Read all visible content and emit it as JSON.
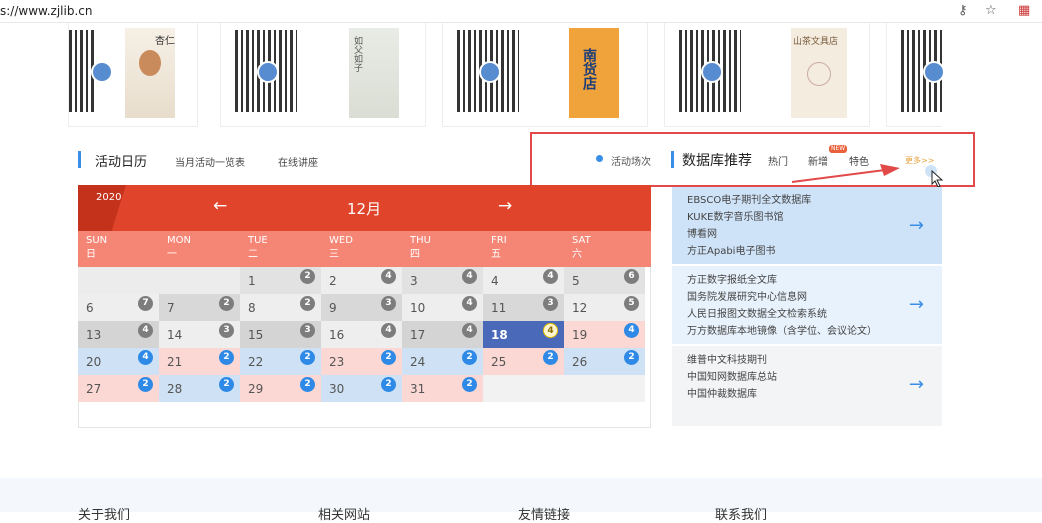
{
  "browser": {
    "url": "s://www.zjlib.cn"
  },
  "activity": {
    "title": "活动日历",
    "tab_month": "当月活动一览表",
    "tab_lecture": "在线讲座",
    "legend": "活动场次"
  },
  "database": {
    "title": "数据库推荐",
    "tab_hot": "热门",
    "tab_new": "新增",
    "new_badge": "NEW",
    "tab_special": "特色",
    "more": "更多>>",
    "groups": [
      {
        "lines": [
          "EBSCO电子期刊全文数据库",
          "KUKE数字音乐图书馆",
          "博看网",
          "方正Apabi电子图书"
        ]
      },
      {
        "lines": [
          "方正数字报纸全文库",
          "国务院发展研究中心信息网",
          "人民日报图文数据全文检索系统",
          "万方数据库本地镜像（含学位、会议论文）"
        ]
      },
      {
        "lines": [
          "维普中文科技期刊",
          "中国知网数据库总站",
          "中国仲裁数据库"
        ]
      }
    ]
  },
  "calendar": {
    "year": "2020",
    "month": "12月",
    "prev_glyph": "←",
    "next_glyph": "→",
    "weekdays": [
      {
        "en": "SUN",
        "cn": "日"
      },
      {
        "en": "MON",
        "cn": "一"
      },
      {
        "en": "TUE",
        "cn": "二"
      },
      {
        "en": "WED",
        "cn": "三"
      },
      {
        "en": "THU",
        "cn": "四"
      },
      {
        "en": "FRI",
        "cn": "五"
      },
      {
        "en": "SAT",
        "cn": "六"
      }
    ],
    "days": [
      {
        "d": "",
        "c": ""
      },
      {
        "d": "",
        "c": ""
      },
      {
        "d": "1",
        "c": "2"
      },
      {
        "d": "2",
        "c": "4"
      },
      {
        "d": "3",
        "c": "4"
      },
      {
        "d": "4",
        "c": "4"
      },
      {
        "d": "5",
        "c": "6"
      },
      {
        "d": "6",
        "c": "7"
      },
      {
        "d": "7",
        "c": "2"
      },
      {
        "d": "8",
        "c": "2"
      },
      {
        "d": "9",
        "c": "3"
      },
      {
        "d": "10",
        "c": "4"
      },
      {
        "d": "11",
        "c": "3"
      },
      {
        "d": "12",
        "c": "5"
      },
      {
        "d": "13",
        "c": "4"
      },
      {
        "d": "14",
        "c": "3"
      },
      {
        "d": "15",
        "c": "3"
      },
      {
        "d": "16",
        "c": "4"
      },
      {
        "d": "17",
        "c": "4"
      },
      {
        "d": "18",
        "c": "4"
      },
      {
        "d": "19",
        "c": "4"
      },
      {
        "d": "20",
        "c": "4"
      },
      {
        "d": "21",
        "c": "2"
      },
      {
        "d": "22",
        "c": "2"
      },
      {
        "d": "23",
        "c": "2"
      },
      {
        "d": "24",
        "c": "2"
      },
      {
        "d": "25",
        "c": "2"
      },
      {
        "d": "26",
        "c": "2"
      },
      {
        "d": "27",
        "c": "2"
      },
      {
        "d": "28",
        "c": "2"
      },
      {
        "d": "29",
        "c": "2"
      },
      {
        "d": "30",
        "c": "2"
      },
      {
        "d": "31",
        "c": "2"
      },
      {
        "d": "",
        "c": ""
      },
      {
        "d": "",
        "c": ""
      }
    ],
    "today": "18"
  },
  "books": [
    {
      "title": "杏仁"
    },
    {
      "title": "如父如子"
    },
    {
      "title": "南货店"
    },
    {
      "title": "山茶文具店"
    }
  ],
  "footer": {
    "items": [
      "关于我们",
      "相关网站",
      "友情链接",
      "联系我们"
    ]
  },
  "colors": {
    "accent": "#3a8ee6",
    "calendar_red": "#e0452b",
    "highlight": "#e24a4a"
  }
}
